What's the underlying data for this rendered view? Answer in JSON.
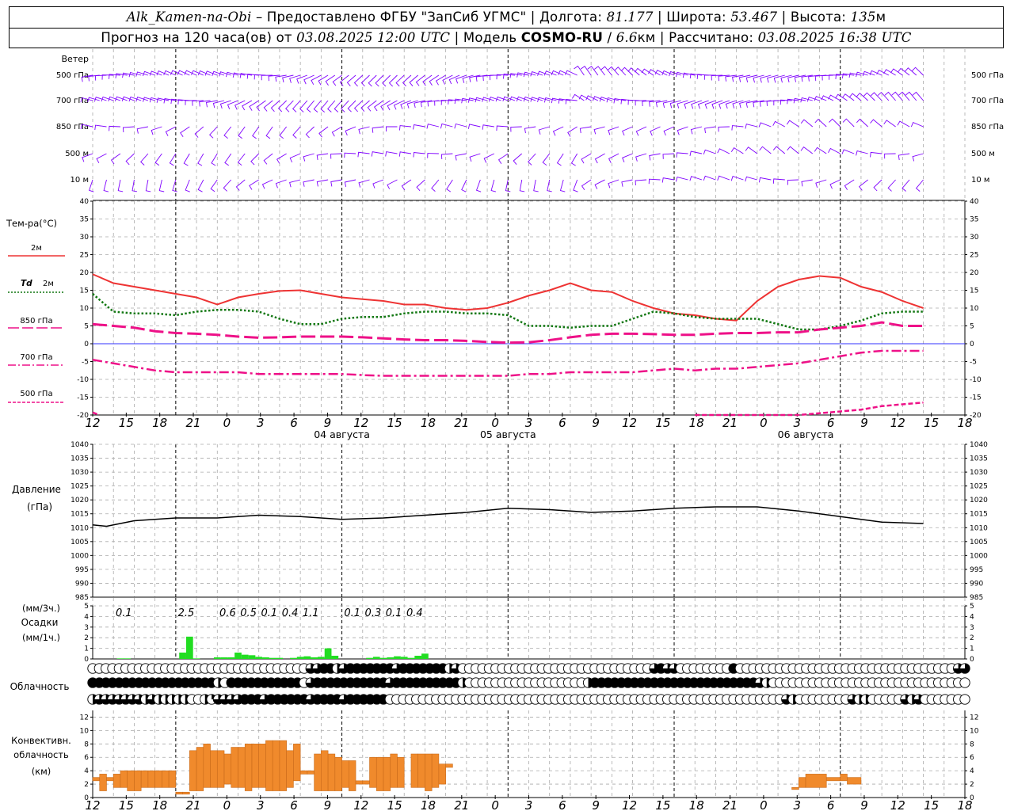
{
  "header": {
    "station": "Alk_Kamen-na-Obi",
    "provider": "Предоставлено ФГБУ \"ЗапСиб УГМС\"",
    "lon_label": "Долгота:",
    "lon_value": "81.177",
    "lat_label": "Широта:",
    "lat_value": "53.467",
    "alt_label": "Высота:",
    "alt_value": "135",
    "alt_unit": "м",
    "forecast_prefix": "Прогноз на 120 часа(ов) от",
    "forecast_base": "03.08.2025 12:00 UTC",
    "model_label": "Модель",
    "model_name": "COSMO-RU",
    "model_res": "6.6",
    "model_res_unit": "км",
    "calc_label": "Рассчитано:",
    "calc_time": "03.08.2025 16:38 UTC"
  },
  "colors": {
    "wind": "#7f00ff",
    "t2m": "#ee3333",
    "td2m": "#117711",
    "t850": "#ee1188",
    "t700": "#ee1188",
    "t500": "#ee1188",
    "zero": "#3333ff",
    "precip": "#22dd22",
    "conv": "#f08a2c",
    "pressure": "#000000"
  },
  "chart_data": [
    {
      "type": "wind_barbs",
      "title": "Ветер",
      "levels": [
        "500 гПа",
        "700 гПа",
        "850 гПа",
        "500 м",
        "10 м"
      ],
      "note": "wind barbs every hour at each level"
    },
    {
      "type": "line",
      "title": "Тем-ра(°C)",
      "ylim": [
        -20,
        40
      ],
      "yticks": [
        -20,
        -15,
        -10,
        -5,
        0,
        5,
        10,
        15,
        20,
        25,
        30,
        35,
        40
      ],
      "x_hours": [
        0,
        3,
        6,
        9,
        12,
        15,
        18,
        21,
        24,
        27,
        30,
        33,
        36,
        39,
        42,
        45,
        48,
        51,
        54,
        57,
        60,
        63,
        66,
        69,
        72,
        75,
        78,
        81,
        84,
        87,
        90,
        93,
        96,
        99,
        102,
        105,
        108,
        111,
        114,
        117,
        120
      ],
      "series": [
        {
          "name": "2м",
          "style": "solid",
          "values": [
            19.5,
            17,
            16,
            15,
            14,
            13,
            11,
            13,
            14,
            14.8,
            15,
            14,
            13,
            12.5,
            12,
            11,
            11,
            10,
            9.5,
            10,
            11.5,
            13.5,
            15,
            17,
            15,
            14.5,
            12,
            10,
            8.5,
            8,
            7,
            6.5,
            12,
            16,
            18,
            19,
            18.5,
            16,
            14.5,
            12,
            10
          ]
        },
        {
          "name": "Td 2м",
          "style": "dotted",
          "values": [
            14,
            9,
            8.5,
            8.5,
            8,
            9,
            9.5,
            9.5,
            9,
            7,
            5.5,
            5.5,
            7,
            7.5,
            7.5,
            8.5,
            9,
            9,
            8.5,
            8.5,
            8,
            5,
            5,
            4.5,
            5,
            5,
            7,
            9,
            8.5,
            7.5,
            7,
            7,
            7,
            5.5,
            4,
            4,
            5,
            6.5,
            8.5,
            9,
            9
          ]
        },
        {
          "name": "850 гПа",
          "style": "dashed",
          "values": [
            5.5,
            5,
            4.5,
            3.5,
            3,
            2.8,
            2.5,
            2,
            1.7,
            1.8,
            2,
            2,
            2,
            1.8,
            1.5,
            1.2,
            1,
            1,
            0.8,
            0.5,
            0.3,
            0.4,
            1,
            1.8,
            2.5,
            2.8,
            2.8,
            2.7,
            2.5,
            2.5,
            2.8,
            3,
            3,
            3.2,
            3.2,
            4,
            4.5,
            5,
            6,
            5,
            5
          ]
        },
        {
          "name": "700 гПа",
          "style": "dashdot",
          "values": [
            -4.5,
            -5.5,
            -6.5,
            -7.5,
            -8,
            -8,
            -8,
            -8,
            -8.5,
            -8.5,
            -8.5,
            -8.5,
            -8.5,
            -8.8,
            -9,
            -9,
            -9,
            -9,
            -9,
            -9,
            -9,
            -8.5,
            -8.5,
            -8,
            -8,
            -8,
            -8,
            -7.5,
            -7,
            -7.5,
            -7,
            -7,
            -6.5,
            -6,
            -5.5,
            -4.5,
            -3.5,
            -2.5,
            -2,
            -2,
            -2
          ]
        },
        {
          "name": "500 гПа",
          "style": "dashed2",
          "values_partial": {
            "x": [
              0,
              1,
              87,
              90,
              93,
              96,
              99,
              102,
              105,
              108,
              111,
              114,
              117,
              120
            ],
            "y": [
              -19.3,
              -20,
              -20,
              -20,
              -20,
              -20,
              -20,
              -20,
              -19.5,
              -19,
              -18.5,
              -17.5,
              -17,
              -16.5
            ]
          }
        }
      ]
    },
    {
      "type": "line",
      "title": "Давление",
      "ylabel": "(гПа)",
      "ylim": [
        985,
        1040
      ],
      "yticks": [
        985,
        990,
        995,
        1000,
        1005,
        1010,
        1015,
        1020,
        1025,
        1030,
        1035,
        1040
      ],
      "x_hours": [
        0,
        2,
        6,
        12,
        18,
        24,
        30,
        36,
        42,
        48,
        54,
        60,
        66,
        72,
        78,
        84,
        90,
        96,
        102,
        108,
        114,
        120
      ],
      "values": [
        1011,
        1010.5,
        1012.5,
        1013.5,
        1013.5,
        1014.5,
        1014,
        1013,
        1013.5,
        1014.5,
        1015.5,
        1017,
        1016.5,
        1015.5,
        1016,
        1017,
        1017.5,
        1017.5,
        1016,
        1014,
        1012,
        1011.5
      ]
    },
    {
      "type": "bar",
      "title": "Осадки",
      "ylabel_top": "(мм/3ч.)",
      "ylabel_bottom": "(мм/1ч.)",
      "ylim": [
        0,
        5
      ],
      "yticks": [
        0,
        1,
        2,
        3,
        4,
        5
      ],
      "hourly_bars": [
        {
          "h": 4,
          "v": 0.05
        },
        {
          "h": 5,
          "v": 0.05
        },
        {
          "h": 13,
          "v": 0.6
        },
        {
          "h": 14,
          "v": 2.1
        },
        {
          "h": 15,
          "v": 0.05
        },
        {
          "h": 18,
          "v": 0.15
        },
        {
          "h": 19,
          "v": 0.15
        },
        {
          "h": 20,
          "v": 0.15
        },
        {
          "h": 21,
          "v": 0.6
        },
        {
          "h": 22,
          "v": 0.4
        },
        {
          "h": 23,
          "v": 0.35
        },
        {
          "h": 24,
          "v": 0.2
        },
        {
          "h": 25,
          "v": 0.15
        },
        {
          "h": 26,
          "v": 0.1
        },
        {
          "h": 27,
          "v": 0.1
        },
        {
          "h": 29,
          "v": 0.1
        },
        {
          "h": 30,
          "v": 0.2
        },
        {
          "h": 31,
          "v": 0.25
        },
        {
          "h": 32,
          "v": 0.15
        },
        {
          "h": 33,
          "v": 0.2
        },
        {
          "h": 34,
          "v": 1.0
        },
        {
          "h": 35,
          "v": 0.3
        },
        {
          "h": 40,
          "v": 0.1
        },
        {
          "h": 41,
          "v": 0.2
        },
        {
          "h": 42,
          "v": 0.1
        },
        {
          "h": 43,
          "v": 0.15
        },
        {
          "h": 44,
          "v": 0.25
        },
        {
          "h": 45,
          "v": 0.2
        },
        {
          "h": 46,
          "v": 0.1
        },
        {
          "h": 47,
          "v": 0.3
        },
        {
          "h": 48,
          "v": 0.5
        }
      ],
      "labels_3h": [
        {
          "h": 4.5,
          "text": "0.1"
        },
        {
          "h": 13.5,
          "text": "2.5"
        },
        {
          "h": 19.5,
          "text": "0.6"
        },
        {
          "h": 22.5,
          "text": "0.5"
        },
        {
          "h": 25.5,
          "text": "0.1"
        },
        {
          "h": 28.5,
          "text": "0.4"
        },
        {
          "h": 31.5,
          "text": "1.1"
        },
        {
          "h": 37.5,
          "text": "0.1"
        },
        {
          "h": 40.5,
          "text": "0.3"
        },
        {
          "h": 43.5,
          "text": "0.1"
        },
        {
          "h": 46.5,
          "text": "0.4"
        }
      ]
    },
    {
      "type": "symbols",
      "title": "Облачность",
      "rows": [
        "0000000000000000000000000000000003344234444444344444442300000000000000000000000000000343300000000400000000000000000000000000000000033",
        "4444444444444444444204444444444403444444444443444444444420000000000000000002444444444444444444444444432000000000000000000000000000000",
        "2333333323222220021333344434444443444434444440000000000000000000000000000000000000000000000000000000000003200000000322000003230000000"
      ],
      "encoding": "0=clear,1=1/4,2=1/2,3=3/4,4=overcast"
    },
    {
      "type": "bar",
      "title": "Конвективн. облачность",
      "ylabel": "(км)",
      "ylim": [
        0,
        13
      ],
      "yticks": [
        0,
        2,
        4,
        6,
        8,
        10,
        12
      ],
      "layers": [
        {
          "h0": 0,
          "h1": 1,
          "bottom": 2.5,
          "top": 3
        },
        {
          "h0": 1,
          "h1": 2,
          "bottom": 1,
          "top": 3.5
        },
        {
          "h0": 2,
          "h1": 3,
          "bottom": 2.5,
          "top": 3
        },
        {
          "h0": 3,
          "h1": 4,
          "bottom": 1.5,
          "top": 3.5
        },
        {
          "h0": 4,
          "h1": 5,
          "bottom": 1.5,
          "top": 4
        },
        {
          "h0": 5,
          "h1": 6,
          "bottom": 1,
          "top": 4
        },
        {
          "h0": 6,
          "h1": 7,
          "bottom": 1,
          "top": 4
        },
        {
          "h0": 7,
          "h1": 8,
          "bottom": 1.5,
          "top": 4
        },
        {
          "h0": 8,
          "h1": 9,
          "bottom": 1.5,
          "top": 4
        },
        {
          "h0": 9,
          "h1": 10,
          "bottom": 1.5,
          "top": 4
        },
        {
          "h0": 10,
          "h1": 11,
          "bottom": 1.5,
          "top": 4
        },
        {
          "h0": 11,
          "h1": 12,
          "bottom": 1.5,
          "top": 4
        },
        {
          "h0": 12,
          "h1": 13,
          "bottom": 0.5,
          "top": 0.8
        },
        {
          "h0": 13,
          "h1": 14,
          "bottom": 0.5,
          "top": 0.8
        },
        {
          "h0": 14,
          "h1": 15,
          "bottom": 1,
          "top": 7
        },
        {
          "h0": 15,
          "h1": 16,
          "bottom": 1,
          "top": 7.5
        },
        {
          "h0": 16,
          "h1": 17,
          "bottom": 1.5,
          "top": 8
        },
        {
          "h0": 17,
          "h1": 18,
          "bottom": 1.5,
          "top": 7
        },
        {
          "h0": 18,
          "h1": 19,
          "bottom": 1.5,
          "top": 7
        },
        {
          "h0": 19,
          "h1": 20,
          "bottom": 2,
          "top": 6.5
        },
        {
          "h0": 20,
          "h1": 21,
          "bottom": 1.5,
          "top": 7.5
        },
        {
          "h0": 21,
          "h1": 22,
          "bottom": 1.5,
          "top": 7.5
        },
        {
          "h0": 22,
          "h1": 23,
          "bottom": 1,
          "top": 8
        },
        {
          "h0": 23,
          "h1": 24,
          "bottom": 1.5,
          "top": 8
        },
        {
          "h0": 24,
          "h1": 25,
          "bottom": 1.5,
          "top": 8
        },
        {
          "h0": 25,
          "h1": 26,
          "bottom": 1,
          "top": 8.5
        },
        {
          "h0": 26,
          "h1": 27,
          "bottom": 1,
          "top": 8.5
        },
        {
          "h0": 27,
          "h1": 28,
          "bottom": 1,
          "top": 8.5
        },
        {
          "h0": 28,
          "h1": 29,
          "bottom": 1.5,
          "top": 7
        },
        {
          "h0": 29,
          "h1": 30,
          "bottom": 2.5,
          "top": 8
        },
        {
          "h0": 30,
          "h1": 31,
          "bottom": 3.5,
          "top": 4
        },
        {
          "h0": 31,
          "h1": 32,
          "bottom": 3.5,
          "top": 4
        },
        {
          "h0": 32,
          "h1": 33,
          "bottom": 1,
          "top": 6.5
        },
        {
          "h0": 33,
          "h1": 34,
          "bottom": 1,
          "top": 7
        },
        {
          "h0": 34,
          "h1": 35,
          "bottom": 1,
          "top": 6.5
        },
        {
          "h0": 35,
          "h1": 36,
          "bottom": 1,
          "top": 6
        },
        {
          "h0": 36,
          "h1": 37,
          "bottom": 1.5,
          "top": 5.5
        },
        {
          "h0": 37,
          "h1": 38,
          "bottom": 1,
          "top": 5.5
        },
        {
          "h0": 38,
          "h1": 39,
          "bottom": 2,
          "top": 2.5
        },
        {
          "h0": 39,
          "h1": 40,
          "bottom": 2,
          "top": 2.5
        },
        {
          "h0": 40,
          "h1": 41,
          "bottom": 1.5,
          "top": 6
        },
        {
          "h0": 41,
          "h1": 42,
          "bottom": 1,
          "top": 6
        },
        {
          "h0": 42,
          "h1": 43,
          "bottom": 1,
          "top": 6
        },
        {
          "h0": 43,
          "h1": 44,
          "bottom": 1.5,
          "top": 6.5
        },
        {
          "h0": 44,
          "h1": 45,
          "bottom": 1.5,
          "top": 6
        },
        {
          "h0": 46,
          "h1": 47,
          "bottom": 1.5,
          "top": 6.5
        },
        {
          "h0": 47,
          "h1": 48,
          "bottom": 1.5,
          "top": 6.5
        },
        {
          "h0": 48,
          "h1": 49,
          "bottom": 1,
          "top": 6.5
        },
        {
          "h0": 49,
          "h1": 50,
          "bottom": 1.5,
          "top": 6.5
        },
        {
          "h0": 50,
          "h1": 51,
          "bottom": 2,
          "top": 5
        },
        {
          "h0": 51,
          "h1": 52,
          "bottom": 4.5,
          "top": 5
        },
        {
          "h0": 101,
          "h1": 102,
          "bottom": 1.2,
          "top": 1.5
        },
        {
          "h0": 102,
          "h1": 103,
          "bottom": 1.5,
          "top": 3
        },
        {
          "h0": 103,
          "h1": 106,
          "bottom": 1.5,
          "top": 3.5
        },
        {
          "h0": 106,
          "h1": 108,
          "bottom": 2.5,
          "top": 3
        },
        {
          "h0": 108,
          "h1": 109,
          "bottom": 2.5,
          "top": 3.5
        },
        {
          "h0": 109,
          "h1": 111,
          "bottom": 2,
          "top": 3
        }
      ]
    }
  ],
  "axis": {
    "hour_labels": [
      "12",
      "15",
      "18",
      "21",
      "0",
      "3",
      "6",
      "9",
      "12",
      "15",
      "18",
      "21",
      "0",
      "3",
      "6",
      "9",
      "12",
      "15",
      "18",
      "21",
      "0",
      "3",
      "6",
      "9",
      "12",
      "15",
      "18"
    ],
    "day_labels": [
      {
        "h": 36,
        "text": "04 августа"
      },
      {
        "h": 60,
        "text": "05 августа"
      },
      {
        "h": 103,
        "text": "06 августа"
      }
    ]
  },
  "legend": {
    "temp_title": "Тем-ра(°C)",
    "t2m": "2м",
    "td_sym": "Td",
    "td2m": "2м",
    "t850": "850 гПа",
    "t700": "700 гПа",
    "t500": "500 гПа",
    "wind_title": "Ветер",
    "wind_levels": [
      "500 гПа",
      "700 гПа",
      "850 гПа",
      "500 м",
      "10 м"
    ],
    "pressure_title": "Давление",
    "pressure_unit": "(гПа)",
    "precip_unit3": "(мм/3ч.)",
    "precip_title": "Осадки",
    "precip_unit1": "(мм/1ч.)",
    "cloud_title": "Облачность",
    "conv_title1": "Конвективн.",
    "conv_title2": "облачность",
    "conv_unit": "(км)"
  }
}
